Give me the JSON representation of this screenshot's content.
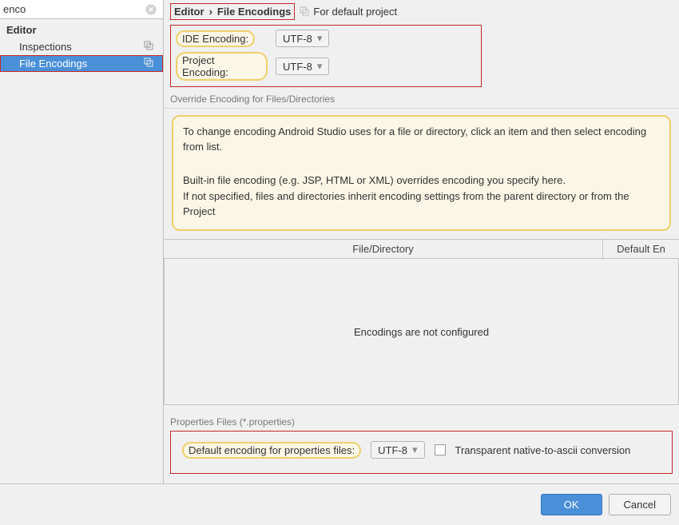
{
  "search": {
    "value": "enco"
  },
  "sidebar": {
    "header": "Editor",
    "items": [
      {
        "label": "Inspections",
        "selected": false
      },
      {
        "label": "File Encodings",
        "selected": true
      }
    ]
  },
  "breadcrumb": {
    "part1": "Editor",
    "part2": "File Encodings",
    "suffix": "For default project"
  },
  "enc": {
    "ideLabel": "IDE Encoding:",
    "ideValue": "UTF-8",
    "projectLabel": "Project Encoding:",
    "projectValue": "UTF-8"
  },
  "overrideSection": "Override Encoding for Files/Directories",
  "hint": {
    "l1": "To change encoding Android Studio uses for a file or directory, click an item and then select encoding from list.",
    "l2": "Built-in file encoding (e.g. JSP, HTML or XML) overrides encoding you specify here.",
    "l3": "If not specified, files and directories inherit encoding settings from the parent directory or from the Project"
  },
  "table": {
    "col1": "File/Directory",
    "col2": "Default En",
    "empty": "Encodings are not configured"
  },
  "props": {
    "sectionTitle": "Properties Files (*.properties)",
    "label": "Default encoding for properties files:",
    "value": "UTF-8",
    "checkboxLabel": "Transparent native-to-ascii conversion"
  },
  "footer": {
    "ok": "OK",
    "cancel": "Cancel"
  },
  "chevron": "›"
}
